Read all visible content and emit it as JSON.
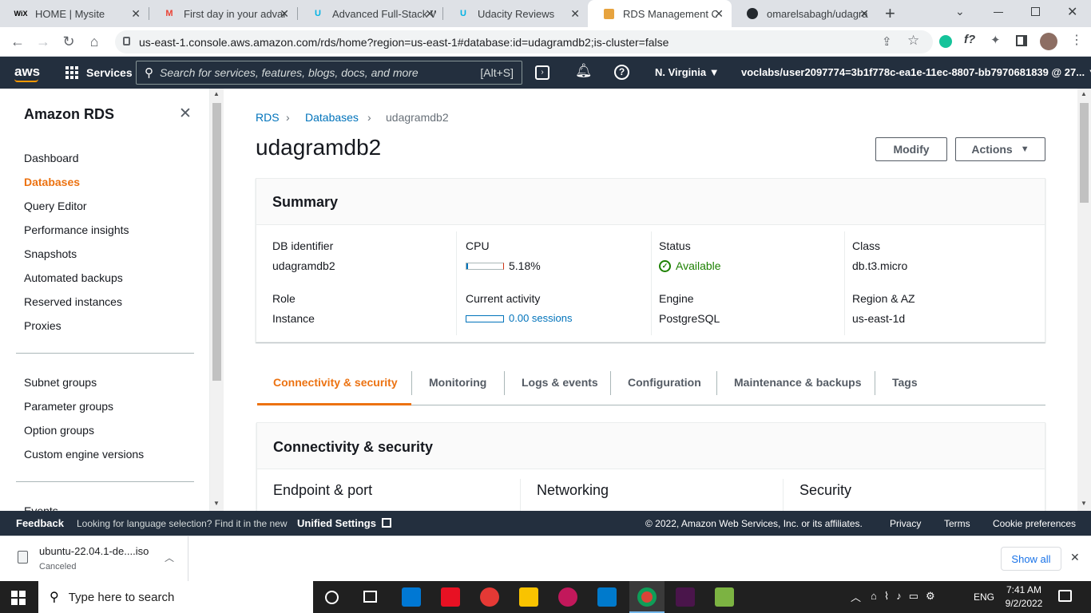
{
  "browser": {
    "tabs": [
      {
        "title": "HOME | Mysite",
        "favicon": "WiX"
      },
      {
        "title": "First day in your advar",
        "favicon": "M"
      },
      {
        "title": "Advanced Full-Stack W",
        "favicon": "U"
      },
      {
        "title": "Udacity Reviews",
        "favicon": "U"
      },
      {
        "title": "RDS Management Co",
        "favicon": "aws-cube"
      },
      {
        "title": "omarelsabagh/udagra",
        "favicon": "github"
      }
    ],
    "url": "us-east-1.console.aws.amazon.com/rds/home?region=us-east-1#database:id=udagramdb2;is-cluster=false"
  },
  "aws_header": {
    "logo": "aws",
    "services_label": "Services",
    "search_placeholder": "Search for services, features, blogs, docs, and more",
    "search_shortcut": "[Alt+S]",
    "region": "N. Virginia",
    "account": "voclabs/user2097774=3b1f778c-ea1e-11ec-8807-bb7970681839 @ 27..."
  },
  "sidebar": {
    "title": "Amazon RDS",
    "items": [
      "Dashboard",
      "Databases",
      "Query Editor",
      "Performance insights",
      "Snapshots",
      "Automated backups",
      "Reserved instances",
      "Proxies"
    ],
    "items2": [
      "Subnet groups",
      "Parameter groups",
      "Option groups",
      "Custom engine versions"
    ],
    "items3": [
      "Events"
    ]
  },
  "main": {
    "breadcrumb": [
      "RDS",
      "Databases",
      "udagramdb2"
    ],
    "title": "udagramdb2",
    "modify_label": "Modify",
    "actions_label": "Actions",
    "summary": {
      "heading": "Summary",
      "db_identifier_label": "DB identifier",
      "db_identifier": "udagramdb2",
      "cpu_label": "CPU",
      "cpu_value": "5.18%",
      "cpu_fraction": 0.0518,
      "status_label": "Status",
      "status": "Available",
      "class_label": "Class",
      "class": "db.t3.micro",
      "role_label": "Role",
      "role": "Instance",
      "activity_label": "Current activity",
      "activity": "0.00 sessions",
      "engine_label": "Engine",
      "engine": "PostgreSQL",
      "region_label": "Region & AZ",
      "region": "us-east-1d"
    },
    "tabs": [
      "Connectivity & security",
      "Monitoring",
      "Logs & events",
      "Configuration",
      "Maintenance & backups",
      "Tags"
    ],
    "section": {
      "heading": "Connectivity & security",
      "col1": "Endpoint & port",
      "col2": "Networking",
      "col3": "Security"
    }
  },
  "footer": {
    "feedback": "Feedback",
    "lang_text": "Looking for language selection? Find it in the new",
    "unified": "Unified Settings",
    "copyright": "© 2022, Amazon Web Services, Inc. or its affiliates.",
    "privacy": "Privacy",
    "terms": "Terms",
    "cookie": "Cookie preferences"
  },
  "download": {
    "filename": "ubuntu-22.04.1-de....iso",
    "status": "Canceled",
    "show_all": "Show all"
  },
  "taskbar": {
    "search_placeholder": "Type here to search",
    "lang": "ENG",
    "time": "7:41 AM",
    "date": "9/2/2022"
  },
  "colors": {
    "aws_nav": "#232f3e",
    "accent": "#ec7211",
    "link": "#0073bb",
    "success": "#1d8102"
  }
}
